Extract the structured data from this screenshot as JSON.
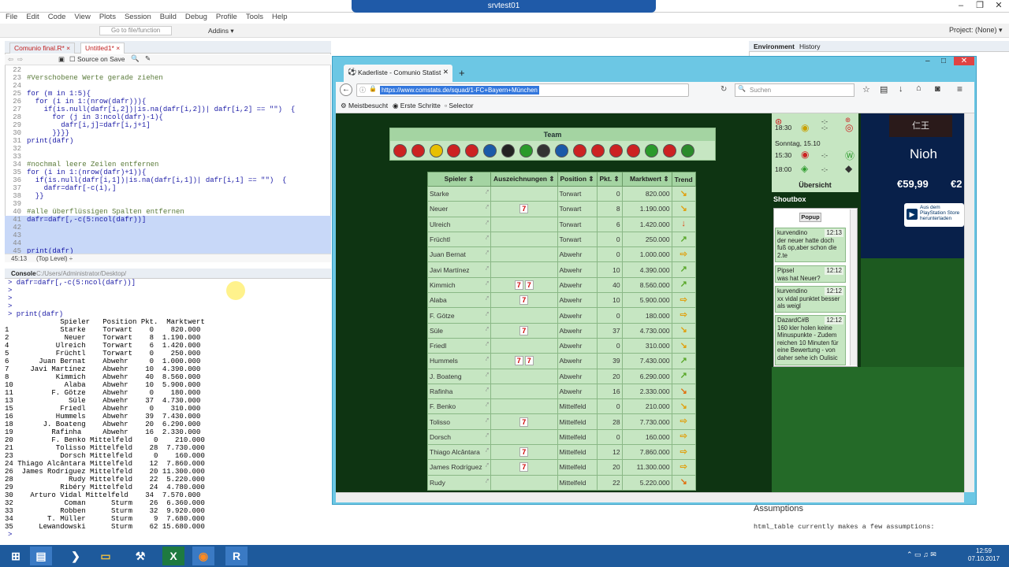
{
  "remote_desktop": {
    "title": "srvtest01"
  },
  "rstudio": {
    "menu": [
      "File",
      "Edit",
      "Code",
      "View",
      "Plots",
      "Session",
      "Build",
      "Debug",
      "Profile",
      "Tools",
      "Help"
    ],
    "goto_placeholder": "Go to file/function",
    "addins": "Addins",
    "project": "Project: (None)",
    "source_tabs": [
      "Comunio final.R*",
      "Untitled1*"
    ],
    "source_on_save": "Source on Save",
    "code_lines": [
      {
        "n": "22",
        "t": "",
        "c": "",
        "h": false
      },
      {
        "n": "23",
        "t": "#Verschobene Werte gerade ziehen",
        "c": "cm",
        "h": false
      },
      {
        "n": "24",
        "t": "",
        "c": "",
        "h": false
      },
      {
        "n": "25",
        "t": "for (m in 1:5){",
        "c": "kw",
        "h": false
      },
      {
        "n": "26",
        "t": "  for (i in 1:(nrow(dafr))){",
        "c": "kw",
        "h": false
      },
      {
        "n": "27",
        "t": "    if(is.null(dafr[i,2])|is.na(dafr[i,2])| dafr[i,2] == \"\")  {",
        "c": "kw",
        "h": false
      },
      {
        "n": "28",
        "t": "      for (j in 3:ncol(dafr)-1){",
        "c": "kw",
        "h": false
      },
      {
        "n": "29",
        "t": "        dafr[i,j]=dafr[i,j+1]",
        "c": "kw",
        "h": false
      },
      {
        "n": "30",
        "t": "      }}}}",
        "c": "kw",
        "h": false
      },
      {
        "n": "31",
        "t": "print(dafr)",
        "c": "kw",
        "h": false
      },
      {
        "n": "32",
        "t": "",
        "c": "",
        "h": false
      },
      {
        "n": "33",
        "t": "",
        "c": "",
        "h": false
      },
      {
        "n": "34",
        "t": "#nochmal leere Zeilen entfernen",
        "c": "cm",
        "h": false
      },
      {
        "n": "35",
        "t": "for (i in 1:(nrow(dafr)+1)){",
        "c": "kw",
        "h": false
      },
      {
        "n": "36",
        "t": "  if(is.null(dafr[i,1])|is.na(dafr[i,1])| dafr[i,1] == \"\")  {",
        "c": "kw",
        "h": false
      },
      {
        "n": "37",
        "t": "    dafr=dafr[-c(i),]",
        "c": "kw",
        "h": false
      },
      {
        "n": "38",
        "t": "  }}",
        "c": "kw",
        "h": false
      },
      {
        "n": "39",
        "t": "",
        "c": "",
        "h": false
      },
      {
        "n": "40",
        "t": "#alle überflüssigen Spalten entfernen",
        "c": "cm",
        "h": false
      },
      {
        "n": "41",
        "t": "dafr=dafr[,-c(5:ncol(dafr))]",
        "c": "kw",
        "h": true
      },
      {
        "n": "42",
        "t": "",
        "c": "",
        "h": true
      },
      {
        "n": "43",
        "t": "",
        "c": "",
        "h": true
      },
      {
        "n": "44",
        "t": "",
        "c": "",
        "h": true
      },
      {
        "n": "45",
        "t": "print(dafr)",
        "c": "kw",
        "h": true
      }
    ],
    "status_pos": "45:13",
    "status_level": "(Top Level) ÷",
    "console_title": "Console",
    "console_path": "C:/Users/Administrator/Desktop/",
    "console_lines": [
      "> dafr=dafr[,-c(5:ncol(dafr))]",
      ">",
      ">",
      ">",
      "> print(dafr)"
    ],
    "console_header": "             Spieler   Position Pkt.  Marktwert",
    "console_rows": [
      "1            Starke    Torwart    0    820.000",
      "2             Neuer    Torwart    8  1.190.000",
      "4           Ulreich    Torwart    6  1.420.000",
      "5           Früchtl    Torwart    0    250.000",
      "6       Juan Bernat    Abwehr     0  1.000.000",
      "7     Javi Martínez    Abwehr    10  4.390.000",
      "8           Kimmich    Abwehr    40  8.560.000",
      "10            Alaba    Abwehr    10  5.900.000",
      "11         F. Götze    Abwehr     0    180.000",
      "13             Süle    Abwehr    37  4.730.000",
      "15           Friedl    Abwehr     0    310.000",
      "16          Hummels    Abwehr    39  7.430.000",
      "18       J. Boateng    Abwehr    20  6.290.000",
      "19         Rafinha     Abwehr    16  2.330.000",
      "20         F. Benko Mittelfeld     0    210.000",
      "21          Tolisso Mittelfeld    28  7.730.000",
      "23           Dorsch Mittelfeld     0    160.000",
      "24 Thiago Alcântara Mittelfeld    12  7.860.000",
      "26  James Rodríguez Mittelfeld    20 11.300.000",
      "28             Rudy Mittelfeld    22  5.220.000",
      "29           Ribéry Mittelfeld    24  4.780.000",
      "30    Arturo Vidal Mittelfeld    34  7.570.000",
      "32            Coman      Sturm    26  6.360.000",
      "33           Robben      Sturm    32  9.920.000",
      "34        T. Müller      Sturm     9  7.680.000",
      "35      Lewandowski      Sturm    62 15.680.000"
    ],
    "console_prompt": ">",
    "env_tabs": [
      "Environment",
      "History"
    ],
    "assumptions_title": "Assumptions",
    "assumptions_text": "html_table currently makes a few assumptions:"
  },
  "firefox": {
    "tab_title": "Kaderliste - Comunio Statist",
    "url": "https://www.comstats.de/squad/1-FC+Bayern+München",
    "search_placeholder": "Suchen",
    "bookmarks": [
      "Meistbesucht",
      "Erste Schritte",
      "Selector"
    ],
    "team_label": "Team",
    "columns": [
      "Spieler ⇕",
      "Auszeichnungen ⇕",
      "Position ⇕",
      "Pkt. ⇕",
      "Marktwert ⇕",
      "Trend"
    ],
    "players": [
      {
        "name": "Starke",
        "awards": "",
        "pos": "Torwart",
        "pkt": "0",
        "mw": "820.000",
        "trend": "↘",
        "tc": "rt"
      },
      {
        "name": "Neuer",
        "awards": "7",
        "pos": "Torwart",
        "pkt": "8",
        "mw": "1.190.000",
        "trend": "↘",
        "tc": "rt"
      },
      {
        "name": "Ulreich",
        "awards": "",
        "pos": "Torwart",
        "pkt": "6",
        "mw": "1.420.000",
        "trend": "↓",
        "tc": "dn"
      },
      {
        "name": "Früchtl",
        "awards": "",
        "pos": "Torwart",
        "pkt": "0",
        "mw": "250.000",
        "trend": "↗",
        "tc": "up"
      },
      {
        "name": "Juan Bernat",
        "awards": "",
        "pos": "Abwehr",
        "pkt": "0",
        "mw": "1.000.000",
        "trend": "⇨",
        "tc": "rt"
      },
      {
        "name": "Javi Martínez",
        "awards": "",
        "pos": "Abwehr",
        "pkt": "10",
        "mw": "4.390.000",
        "trend": "↗",
        "tc": "up"
      },
      {
        "name": "Kimmich",
        "awards": "7 7",
        "pos": "Abwehr",
        "pkt": "40",
        "mw": "8.560.000",
        "trend": "↗",
        "tc": "up"
      },
      {
        "name": "Alaba",
        "awards": "7",
        "pos": "Abwehr",
        "pkt": "10",
        "mw": "5.900.000",
        "trend": "⇨",
        "tc": "rt"
      },
      {
        "name": "F. Götze",
        "awards": "",
        "pos": "Abwehr",
        "pkt": "0",
        "mw": "180.000",
        "trend": "⇨",
        "tc": "rt"
      },
      {
        "name": "Süle",
        "awards": "7",
        "pos": "Abwehr",
        "pkt": "37",
        "mw": "4.730.000",
        "trend": "↘",
        "tc": "rt"
      },
      {
        "name": "Friedl",
        "awards": "",
        "pos": "Abwehr",
        "pkt": "0",
        "mw": "310.000",
        "trend": "↘",
        "tc": "rt"
      },
      {
        "name": "Hummels",
        "awards": "7 7",
        "pos": "Abwehr",
        "pkt": "39",
        "mw": "7.430.000",
        "trend": "↗",
        "tc": "up"
      },
      {
        "name": "J. Boateng",
        "awards": "",
        "pos": "Abwehr",
        "pkt": "20",
        "mw": "6.290.000",
        "trend": "↗",
        "tc": "up"
      },
      {
        "name": "Rafinha",
        "awards": "",
        "pos": "Abwehr",
        "pkt": "16",
        "mw": "2.330.000",
        "trend": "↘",
        "tc": "dr"
      },
      {
        "name": "F. Benko",
        "awards": "",
        "pos": "Mittelfeld",
        "pkt": "0",
        "mw": "210.000",
        "trend": "↘",
        "tc": "rt"
      },
      {
        "name": "Tolisso",
        "awards": "7",
        "pos": "Mittelfeld",
        "pkt": "28",
        "mw": "7.730.000",
        "trend": "⇨",
        "tc": "rt"
      },
      {
        "name": "Dorsch",
        "awards": "",
        "pos": "Mittelfeld",
        "pkt": "0",
        "mw": "160.000",
        "trend": "⇨",
        "tc": "rt"
      },
      {
        "name": "Thiago Alcântara",
        "awards": "7",
        "pos": "Mittelfeld",
        "pkt": "12",
        "mw": "7.860.000",
        "trend": "⇨",
        "tc": "rt"
      },
      {
        "name": "James Rodríguez",
        "awards": "7",
        "pos": "Mittelfeld",
        "pkt": "20",
        "mw": "11.300.000",
        "trend": "⇨",
        "tc": "rt"
      },
      {
        "name": "Rudy",
        "awards": "",
        "pos": "Mittelfeld",
        "pkt": "22",
        "mw": "5.220.000",
        "trend": "↘",
        "tc": "dr"
      }
    ],
    "schedule": [
      {
        "time": "18:30",
        "score": "-:-"
      },
      {
        "day": "Sonntag, 15.10"
      },
      {
        "time": "15:30",
        "score": "-:-"
      },
      {
        "time": "18:00",
        "score": "-:-"
      }
    ],
    "overview_label": "Übersicht",
    "shoutbox_title": "Shoutbox",
    "popup_label": "Popup",
    "messages": [
      {
        "user": "kurvendino",
        "time": "12:13",
        "text": "der neuer hatte doch fuß op,aber schon die 2.te"
      },
      {
        "user": "Pipsel",
        "time": "12:12",
        "text": "was hat Neuer?"
      },
      {
        "user": "kurvendino",
        "time": "12:12",
        "text": "xx vidal punktet besser als weigl"
      },
      {
        "user": "DazardC#B",
        "time": "12:12",
        "text": "160 kler holen keine Minuspunkte - Zudem reichen 10 Minuten für eine Bewertung - von daher sehe ich Oulisic"
      }
    ],
    "ad": {
      "title": "Nioh",
      "subtitle": "仁王",
      "price": "€59,99",
      "price2": "€2",
      "store": "Aus dem PlayStation Store herunterladen"
    }
  },
  "taskbar": {
    "time": "12:59",
    "date": "07.10.2017"
  }
}
